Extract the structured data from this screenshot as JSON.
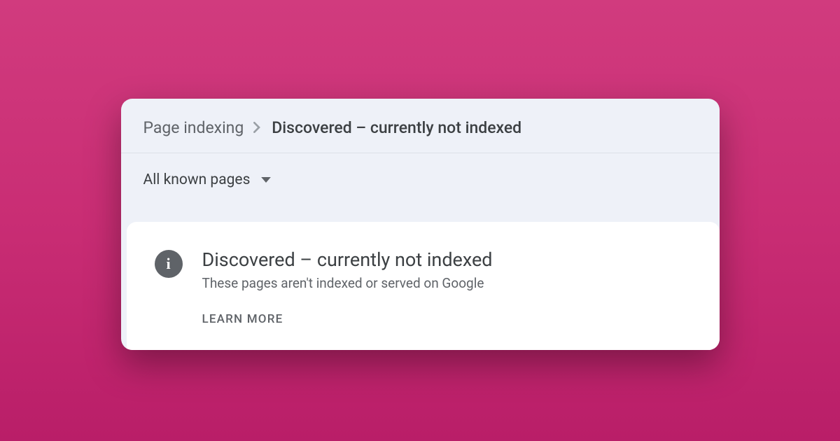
{
  "breadcrumb": {
    "parent": "Page indexing",
    "current": "Discovered – currently not indexed"
  },
  "filter": {
    "selected": "All known pages"
  },
  "status_card": {
    "title": "Discovered – currently not indexed",
    "subtitle": "These pages aren't indexed or served on Google",
    "learn_more": "LEARN MORE"
  }
}
